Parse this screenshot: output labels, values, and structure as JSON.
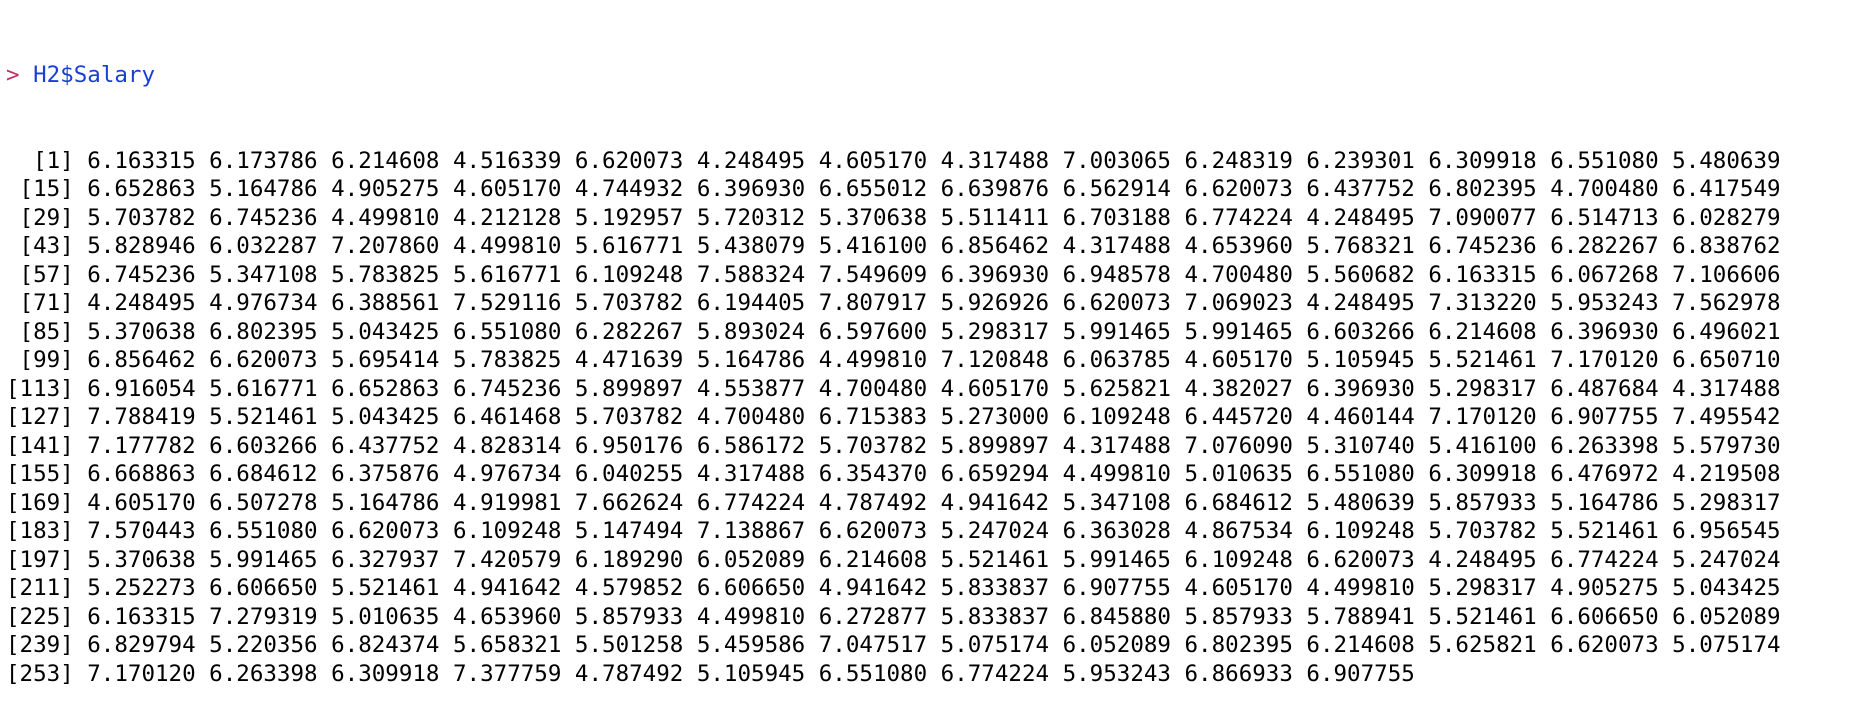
{
  "console": {
    "prompt": "> ",
    "command": "H2$Salary",
    "output": [
      {
        "index": "[1]",
        "values": "6.163315 6.173786 6.214608 4.516339 6.620073 4.248495 4.605170 4.317488 7.003065 6.248319 6.239301 6.309918 6.551080 5.480639"
      },
      {
        "index": "[15]",
        "values": "6.652863 5.164786 4.905275 4.605170 4.744932 6.396930 6.655012 6.639876 6.562914 6.620073 6.437752 6.802395 4.700480 6.417549"
      },
      {
        "index": "[29]",
        "values": "5.703782 6.745236 4.499810 4.212128 5.192957 5.720312 5.370638 5.511411 6.703188 6.774224 4.248495 7.090077 6.514713 6.028279"
      },
      {
        "index": "[43]",
        "values": "5.828946 6.032287 7.207860 4.499810 5.616771 5.438079 5.416100 6.856462 4.317488 4.653960 5.768321 6.745236 6.282267 6.838762"
      },
      {
        "index": "[57]",
        "values": "6.745236 5.347108 5.783825 5.616771 6.109248 7.588324 7.549609 6.396930 6.948578 4.700480 5.560682 6.163315 6.067268 7.106606"
      },
      {
        "index": "[71]",
        "values": "4.248495 4.976734 6.388561 7.529116 5.703782 6.194405 7.807917 5.926926 6.620073 7.069023 4.248495 7.313220 5.953243 7.562978"
      },
      {
        "index": "[85]",
        "values": "5.370638 6.802395 5.043425 6.551080 6.282267 5.893024 6.597600 5.298317 5.991465 5.991465 6.603266 6.214608 6.396930 6.496021"
      },
      {
        "index": "[99]",
        "values": "6.856462 6.620073 5.695414 5.783825 4.471639 5.164786 4.499810 7.120848 6.063785 4.605170 5.105945 5.521461 7.170120 6.650710"
      },
      {
        "index": "[113]",
        "values": "6.916054 5.616771 6.652863 6.745236 5.899897 4.553877 4.700480 4.605170 5.625821 4.382027 6.396930 5.298317 6.487684 4.317488"
      },
      {
        "index": "[127]",
        "values": "7.788419 5.521461 5.043425 6.461468 5.703782 4.700480 6.715383 5.273000 6.109248 6.445720 4.460144 7.170120 6.907755 7.495542"
      },
      {
        "index": "[141]",
        "values": "7.177782 6.603266 6.437752 4.828314 6.950176 6.586172 5.703782 5.899897 4.317488 7.076090 5.310740 5.416100 6.263398 5.579730"
      },
      {
        "index": "[155]",
        "values": "6.668863 6.684612 6.375876 4.976734 6.040255 4.317488 6.354370 6.659294 4.499810 5.010635 6.551080 6.309918 6.476972 4.219508"
      },
      {
        "index": "[169]",
        "values": "4.605170 6.507278 5.164786 4.919981 7.662624 6.774224 4.787492 4.941642 5.347108 6.684612 5.480639 5.857933 5.164786 5.298317"
      },
      {
        "index": "[183]",
        "values": "7.570443 6.551080 6.620073 6.109248 5.147494 7.138867 6.620073 5.247024 6.363028 4.867534 6.109248 5.703782 5.521461 6.956545"
      },
      {
        "index": "[197]",
        "values": "5.370638 5.991465 6.327937 7.420579 6.189290 6.052089 6.214608 5.521461 5.991465 6.109248 6.620073 4.248495 6.774224 5.247024"
      },
      {
        "index": "[211]",
        "values": "5.252273 6.606650 5.521461 4.941642 4.579852 6.606650 4.941642 5.833837 6.907755 4.605170 4.499810 5.298317 4.905275 5.043425"
      },
      {
        "index": "[225]",
        "values": "6.163315 7.279319 5.010635 4.653960 5.857933 4.499810 6.272877 5.833837 6.845880 5.857933 5.788941 5.521461 6.606650 6.052089"
      },
      {
        "index": "[239]",
        "values": "6.829794 5.220356 6.824374 5.658321 5.501258 5.459586 7.047517 5.075174 6.052089 6.802395 6.214608 5.625821 6.620073 5.075174"
      },
      {
        "index": "[253]",
        "values": "7.170120 6.263398 6.309918 7.377759 4.787492 5.105945 6.551080 6.774224 5.953243 6.866933 6.907755"
      }
    ]
  },
  "colors": {
    "prompt": "#c0306a",
    "command": "#1a3fd6",
    "output_text": "#000000",
    "background": "#ffffff"
  }
}
